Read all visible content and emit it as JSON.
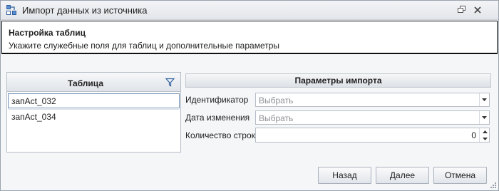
{
  "window": {
    "title": "Импорт данных из источника"
  },
  "header": {
    "title": "Настройка таблиц",
    "subtitle": "Укажите служебные поля для таблиц и дополнительные параметры"
  },
  "table": {
    "column_header": "Таблица",
    "rows": [
      "запAct_032",
      "запAct_034"
    ]
  },
  "params": {
    "header": "Параметры импорта",
    "identifier": {
      "label": "Идентификатор",
      "placeholder": "Выбрать"
    },
    "modified": {
      "label": "Дата изменения",
      "placeholder": "Выбрать"
    },
    "row_count": {
      "label": "Количество строк",
      "value": "0"
    }
  },
  "buttons": {
    "back": "Назад",
    "next": "Далее",
    "cancel": "Отмена"
  },
  "icons": {
    "app": "import-icon",
    "restore": "restore-icon",
    "close": "close-icon",
    "filter": "filter-icon",
    "dropdown": "chevron-down-icon"
  },
  "colors": {
    "accent": "#6e8fb6",
    "placeholder": "#8d8f93"
  }
}
